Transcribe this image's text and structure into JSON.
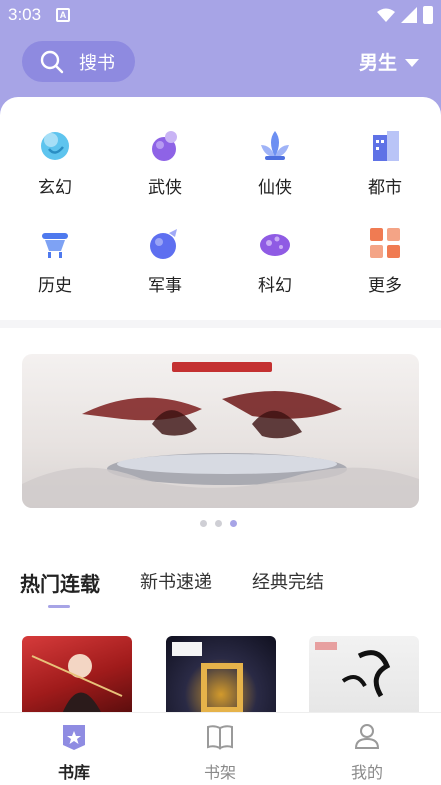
{
  "status_bar": {
    "time": "3:03",
    "notification_icon": "A"
  },
  "header": {
    "search_label": "搜书",
    "gender_label": "男生"
  },
  "categories": [
    {
      "label": "玄幻",
      "icon": "fantasy-icon"
    },
    {
      "label": "武侠",
      "icon": "martial-arts-icon"
    },
    {
      "label": "仙侠",
      "icon": "xianxia-icon"
    },
    {
      "label": "都市",
      "icon": "city-icon"
    },
    {
      "label": "历史",
      "icon": "history-icon"
    },
    {
      "label": "军事",
      "icon": "military-icon"
    },
    {
      "label": "科幻",
      "icon": "scifi-icon"
    },
    {
      "label": "更多",
      "icon": "more-icon"
    }
  ],
  "banner": {
    "active_dot": 2,
    "dot_count": 3
  },
  "tabs": [
    {
      "label": "热门连载",
      "active": true
    },
    {
      "label": "新书速递",
      "active": false
    },
    {
      "label": "经典完结",
      "active": false
    }
  ],
  "bottom_nav": [
    {
      "label": "书库",
      "active": true,
      "icon": "library-icon"
    },
    {
      "label": "书架",
      "active": false,
      "icon": "bookshelf-icon"
    },
    {
      "label": "我的",
      "active": false,
      "icon": "profile-icon"
    }
  ],
  "colors": {
    "accent": "#a7a4e6",
    "search_bg": "#8e8ae0"
  }
}
